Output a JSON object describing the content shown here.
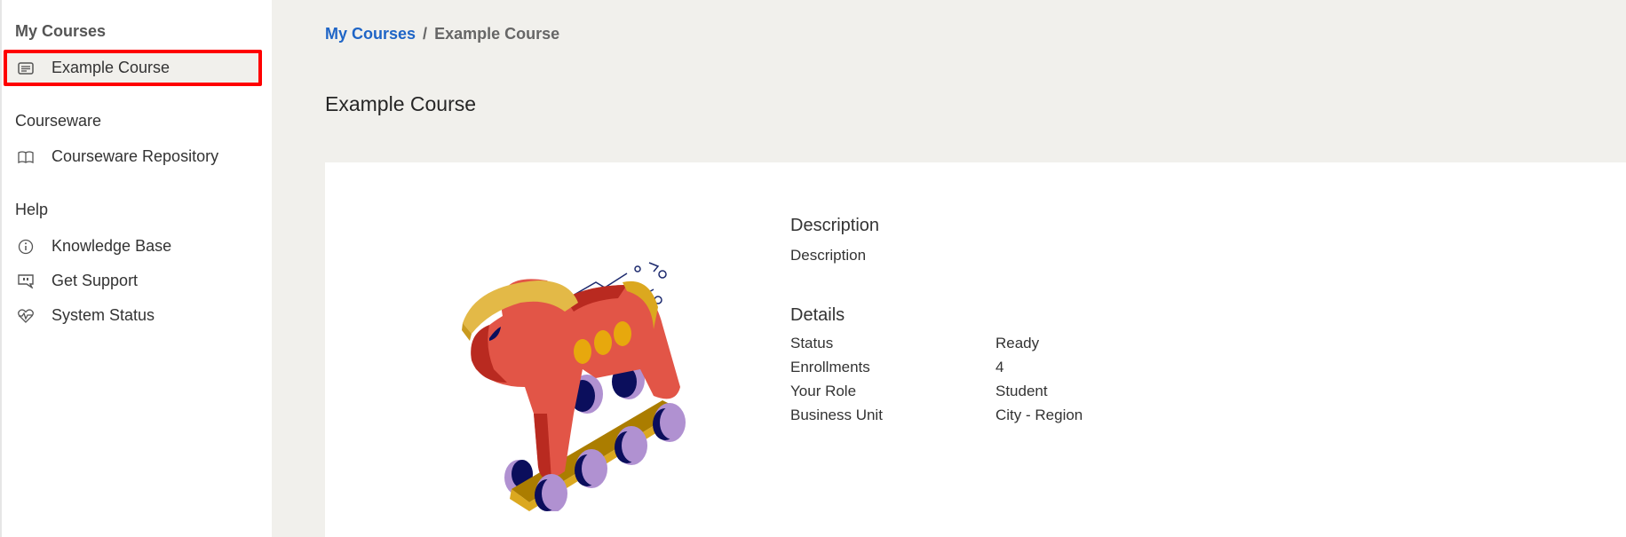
{
  "sidebar": {
    "sections": [
      {
        "title": "My Courses",
        "items": [
          {
            "label": "Example Course",
            "icon": "document-icon",
            "active": true
          }
        ]
      },
      {
        "title": "Courseware",
        "items": [
          {
            "label": "Courseware Repository",
            "icon": "book-icon"
          }
        ]
      },
      {
        "title": "Help",
        "items": [
          {
            "label": "Knowledge Base",
            "icon": "info-icon"
          },
          {
            "label": "Get Support",
            "icon": "chat-icon"
          },
          {
            "label": "System Status",
            "icon": "heart-pulse-icon"
          }
        ]
      }
    ]
  },
  "breadcrumb": {
    "root": "My Courses",
    "separator": "/",
    "current": "Example Course"
  },
  "page": {
    "title": "Example Course"
  },
  "course": {
    "description_heading": "Description",
    "description_text": "Description",
    "details_heading": "Details",
    "details": [
      {
        "label": "Status",
        "value": "Ready"
      },
      {
        "label": "Enrollments",
        "value": "4"
      },
      {
        "label": "Your Role",
        "value": "Student"
      },
      {
        "label": "Business Unit",
        "value": "City - Region"
      }
    ]
  },
  "colors": {
    "accent": "#1f65c6",
    "highlight_border": "#ff0000",
    "background": "#f1f0ec"
  }
}
